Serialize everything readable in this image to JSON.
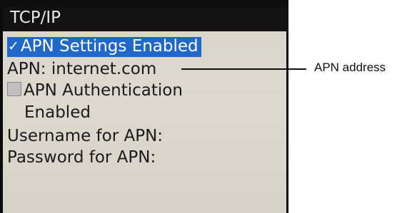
{
  "screen": {
    "title": "TCP/IP",
    "items": [
      {
        "label": "APN Settings Enabled",
        "checked": true,
        "selected": true
      },
      {
        "label": "APN: internet.com"
      },
      {
        "label_line1": "APN Authentication",
        "label_line2": "Enabled",
        "checked": false
      },
      {
        "label": "Username for APN:"
      },
      {
        "label": "Password for APN:"
      }
    ]
  },
  "annotation": {
    "label": "APN address"
  },
  "colors": {
    "selection": "#1f67c9",
    "title_bar": "#121212",
    "screen_background": "#d9d6cc"
  },
  "icons": {
    "checked": "check-icon",
    "unchecked": "checkbox-icon"
  }
}
